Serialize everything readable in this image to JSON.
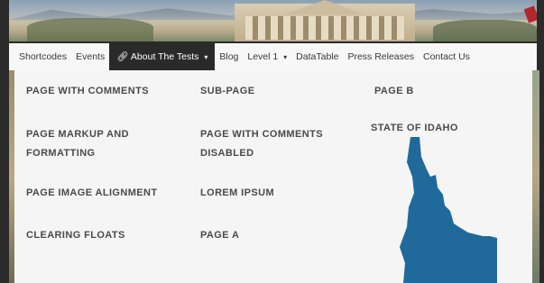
{
  "nav": {
    "items": [
      {
        "label": "Shortcodes"
      },
      {
        "label": "Events"
      },
      {
        "label": "About The Tests",
        "active": true
      },
      {
        "label": "Blog"
      },
      {
        "label": "Level 1"
      },
      {
        "label": "DataTable"
      },
      {
        "label": "Press Releases"
      },
      {
        "label": "Contact Us"
      }
    ],
    "active_icon": "link-icon",
    "caret": "▾"
  },
  "menu": {
    "col1": [
      "PAGE WITH COMMENTS",
      "PAGE MARKUP AND FORMATTING",
      "PAGE IMAGE ALIGNMENT",
      "CLEARING FLOATS"
    ],
    "col2": [
      "SUB-PAGE",
      "PAGE WITH COMMENTS DISABLED",
      "LOREM IPSUM",
      "PAGE A"
    ],
    "col3": [
      "PAGE B",
      "STATE OF IDAHO"
    ]
  },
  "colors": {
    "accent": "#1f6a9a",
    "nav_active_bg": "#2a2a2a",
    "menu_bg": "#f5f5f5"
  }
}
